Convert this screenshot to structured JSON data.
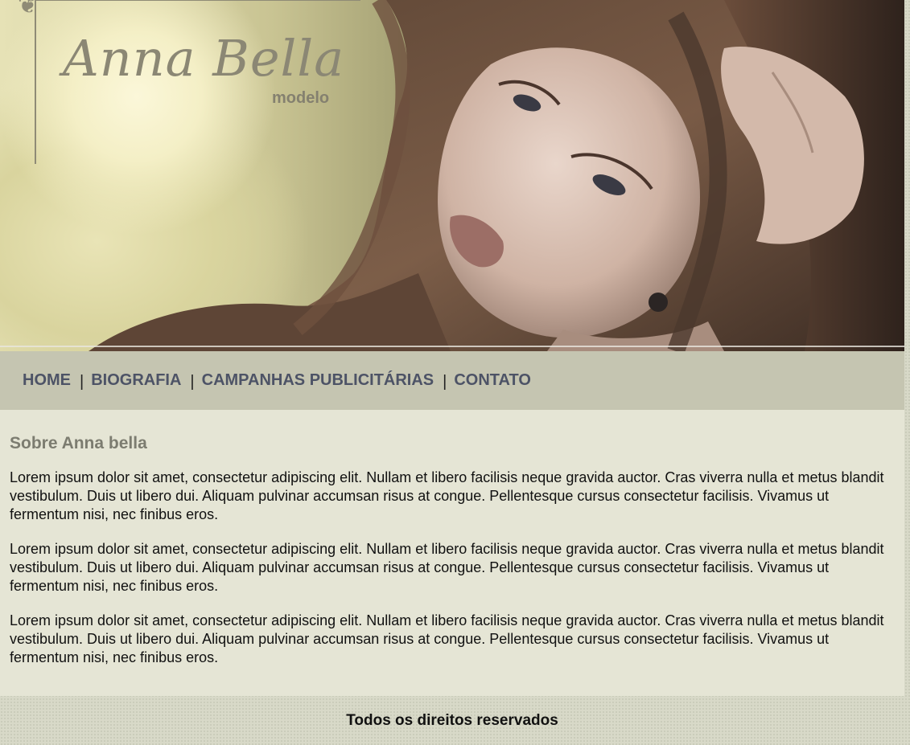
{
  "logo": {
    "name": "Anna Bella",
    "subtitle": "modelo"
  },
  "nav": {
    "items": [
      {
        "label": "HOME"
      },
      {
        "label": "BIOGRAFIA"
      },
      {
        "label": "CAMPANHAS PUBLICITÁRIAS"
      },
      {
        "label": "CONTATO"
      }
    ],
    "separator": "|"
  },
  "main": {
    "heading": "Sobre Anna bella",
    "paragraphs": [
      "Lorem ipsum dolor sit amet, consectetur adipiscing elit. Nullam et libero facilisis neque gravida auctor. Cras viverra nulla et metus blandit vestibulum. Duis ut libero dui. Aliquam pulvinar accumsan risus at congue. Pellentesque cursus consectetur facilisis. Vivamus ut fermentum nisi, nec finibus eros.",
      "Lorem ipsum dolor sit amet, consectetur adipiscing elit. Nullam et libero facilisis neque gravida auctor. Cras viverra nulla et metus blandit vestibulum. Duis ut libero dui. Aliquam pulvinar accumsan risus at congue. Pellentesque cursus consectetur facilisis. Vivamus ut fermentum nisi, nec finibus eros.",
      "Lorem ipsum dolor sit amet, consectetur adipiscing elit. Nullam et libero facilisis neque gravida auctor. Cras viverra nulla et metus blandit vestibulum. Duis ut libero dui. Aliquam pulvinar accumsan risus at congue. Pellentesque cursus consectetur facilisis. Vivamus ut fermentum nisi, nec finibus eros."
    ]
  },
  "footer": {
    "text": "Todos os direitos reservados"
  },
  "colors": {
    "nav_bg": "#c5c5b1",
    "nav_link": "#4d5366",
    "content_bg": "#e5e5d5",
    "heading": "#7c7c70"
  }
}
